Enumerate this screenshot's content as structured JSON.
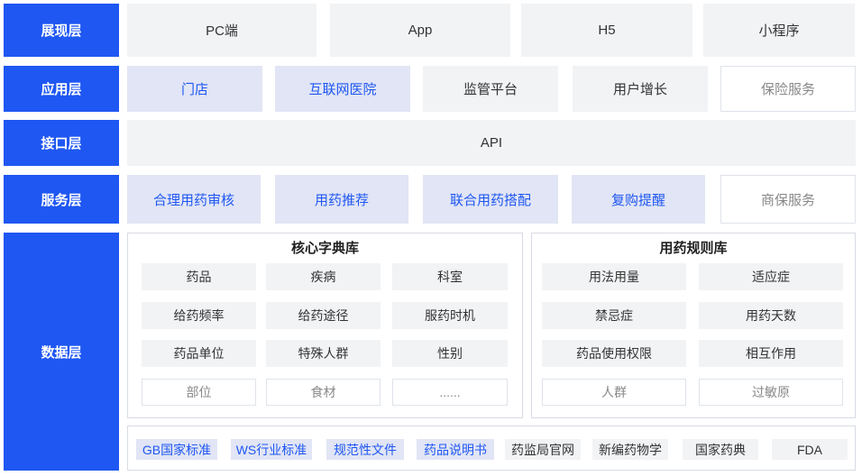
{
  "layers": {
    "presentation": {
      "label": "展现层",
      "items": [
        "PC端",
        "App",
        "H5",
        "小程序"
      ]
    },
    "application": {
      "label": "应用层",
      "items": [
        "门店",
        "互联网医院",
        "监管平台",
        "用户增长",
        "保险服务"
      ]
    },
    "interface": {
      "label": "接口层",
      "item": "API"
    },
    "service": {
      "label": "服务层",
      "items": [
        "合理用药审核",
        "用药推荐",
        "联合用药搭配",
        "复购提醒",
        "商保服务"
      ]
    },
    "data": {
      "label": "数据层",
      "core_dict": {
        "title": "核心字典库",
        "items": [
          "药品",
          "疾病",
          "科室",
          "给药频率",
          "给药途径",
          "服药时机",
          "药品单位",
          "特殊人群",
          "性别",
          "部位",
          "食材",
          "......"
        ]
      },
      "rules": {
        "title": "用药规则库",
        "items": [
          "用法用量",
          "适应症",
          "禁忌症",
          "用药天数",
          "药品使用权限",
          "相互作用",
          "人群",
          "过敏原"
        ]
      },
      "sources": [
        "GB国家标准",
        "WS行业标准",
        "规范性文件",
        "药品说明书",
        "药监局官网",
        "新编药物学",
        "国家药典",
        "FDA"
      ]
    }
  },
  "colors": {
    "accent": "#1f57f2",
    "highlight_bg": "#e1e5f5",
    "gray_bg": "#f2f3f5"
  }
}
